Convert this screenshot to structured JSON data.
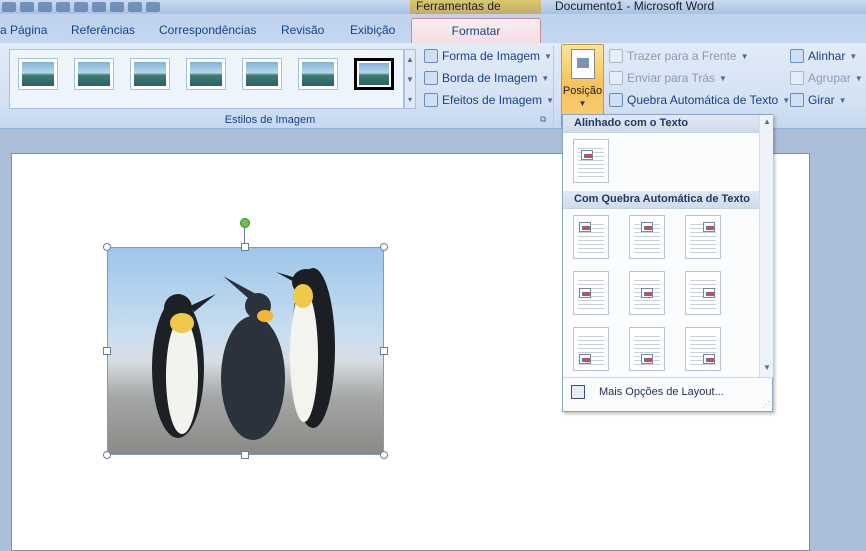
{
  "window": {
    "context_tab_group": "Ferramentas de Imagem",
    "title": "Documento1 - Microsoft Word"
  },
  "tabs": [
    {
      "label": "a Página",
      "active": false
    },
    {
      "label": "Referências",
      "active": false
    },
    {
      "label": "Correspondências",
      "active": false
    },
    {
      "label": "Revisão",
      "active": false
    },
    {
      "label": "Exibição",
      "active": false
    },
    {
      "label": "Formatar",
      "active": true
    }
  ],
  "ribbon": {
    "picture_styles": {
      "group_label": "Estilos de Imagem",
      "styles_count_visible": 7,
      "selected_index": 6,
      "forma_label": "Forma de Imagem",
      "borda_label": "Borda de Imagem",
      "efeitos_label": "Efeitos de Imagem"
    },
    "arrange": {
      "posicao_label": "Posição",
      "trazer_label": "Trazer para a Frente",
      "enviar_label": "Enviar para Trás",
      "quebra_label": "Quebra Automática de Texto",
      "alinhar_label": "Alinhar",
      "agrupar_label": "Agrupar",
      "girar_label": "Girar"
    }
  },
  "position_menu": {
    "inline_header": "Alinhado com o Texto",
    "wrap_header": "Com Quebra Automática de Texto",
    "more_options": "Mais Opções de Layout..."
  },
  "colors": {
    "ribbon_bg": "#dbe6f4",
    "active_tab": "#f3dde2",
    "position_button": "#f7c059",
    "rotate_handle": "#6cc24a"
  }
}
